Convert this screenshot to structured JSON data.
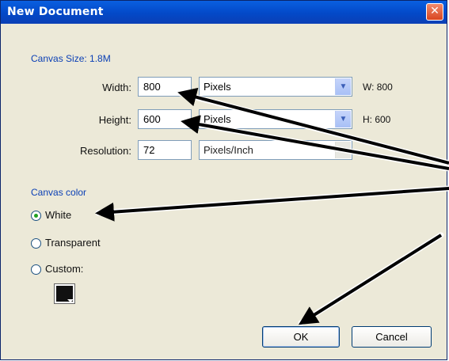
{
  "dialog": {
    "title": "New Document",
    "close_label": "✕"
  },
  "canvas_size": {
    "legend": "Canvas Size: 1.8M",
    "width": {
      "label": "Width:",
      "value": "800",
      "unit": "Pixels",
      "readout": "W: 800"
    },
    "height": {
      "label": "Height:",
      "value": "600",
      "unit": "Pixels",
      "readout": "H: 600"
    },
    "resolution": {
      "label": "Resolution:",
      "value": "72",
      "unit": "Pixels/Inch"
    }
  },
  "canvas_color": {
    "legend": "Canvas color",
    "options": [
      {
        "label": "White",
        "selected": true
      },
      {
        "label": "Transparent",
        "selected": false
      },
      {
        "label": "Custom:",
        "selected": false
      }
    ],
    "custom_swatch_color": "#111111"
  },
  "buttons": {
    "ok_label": "OK",
    "cancel_label": "Cancel"
  },
  "colors": {
    "titlebar": "#0349C8",
    "accent_text": "#0A3FB5",
    "arrow": "#000000"
  }
}
